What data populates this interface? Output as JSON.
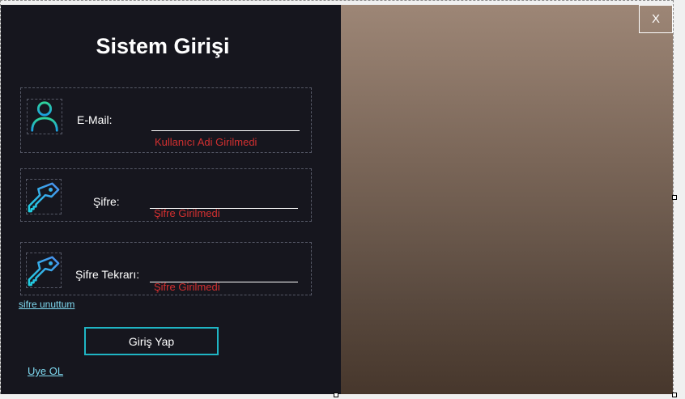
{
  "title": "Sistem Girişi",
  "close_label": "X",
  "email": {
    "label": "E-Mail:",
    "value": "",
    "placeholder": "",
    "error": "Kullanıcı Adi Girilmedi",
    "icon": "user-icon"
  },
  "password": {
    "label": "Şifre:",
    "value": "",
    "placeholder": "",
    "error": "Şifre Girilmedi",
    "icon": "key-icon"
  },
  "password_repeat": {
    "label": "Şifre Tekrarı:",
    "value": "",
    "placeholder": "",
    "error": "Şifre Girilmedi",
    "icon": "key-icon"
  },
  "forgot_link": "sifre unuttum",
  "login_button": "Giriş Yap",
  "register_link": "Uye OL",
  "colors": {
    "panel": "#16161e",
    "accent": "#1fb5c4",
    "error": "#d33030",
    "link": "#7fd9f0"
  }
}
